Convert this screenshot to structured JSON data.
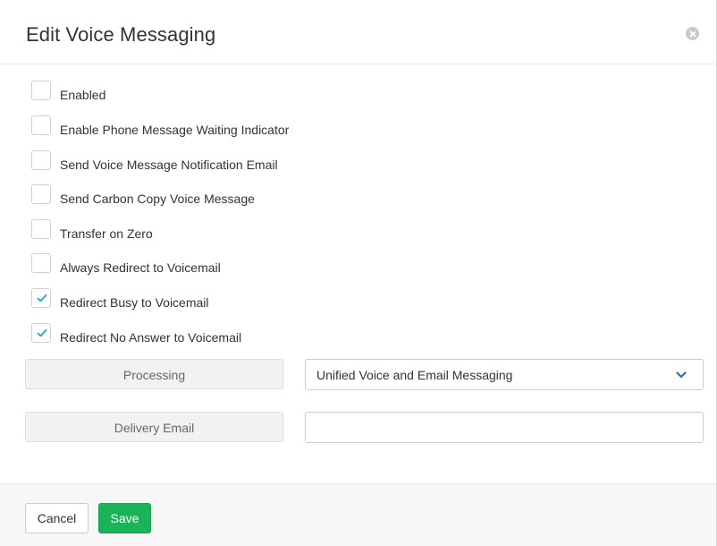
{
  "dialog": {
    "title": "Edit Voice Messaging",
    "close_icon": "close-circle-icon"
  },
  "options": [
    {
      "key": "enabled",
      "label": "Enabled",
      "checked": false
    },
    {
      "key": "mwi",
      "label": "Enable Phone Message Waiting Indicator",
      "checked": false
    },
    {
      "key": "notify-email",
      "label": "Send Voice Message Notification Email",
      "checked": false
    },
    {
      "key": "carbon-copy",
      "label": "Send Carbon Copy Voice Message",
      "checked": false
    },
    {
      "key": "transfer-zero",
      "label": "Transfer on Zero",
      "checked": false
    },
    {
      "key": "always-redirect",
      "label": "Always Redirect to Voicemail",
      "checked": false
    },
    {
      "key": "redirect-busy",
      "label": "Redirect Busy to Voicemail",
      "checked": true
    },
    {
      "key": "redirect-no-answer",
      "label": "Redirect No Answer to Voicemail",
      "checked": true
    }
  ],
  "processing": {
    "label": "Processing",
    "selected": "Unified Voice and Email Messaging",
    "icon": "chevron-down-icon"
  },
  "delivery_email": {
    "label": "Delivery Email",
    "value": ""
  },
  "footer": {
    "cancel_label": "Cancel",
    "save_label": "Save"
  },
  "colors": {
    "check": "#2bb3c0",
    "save": "#1bb35a"
  }
}
